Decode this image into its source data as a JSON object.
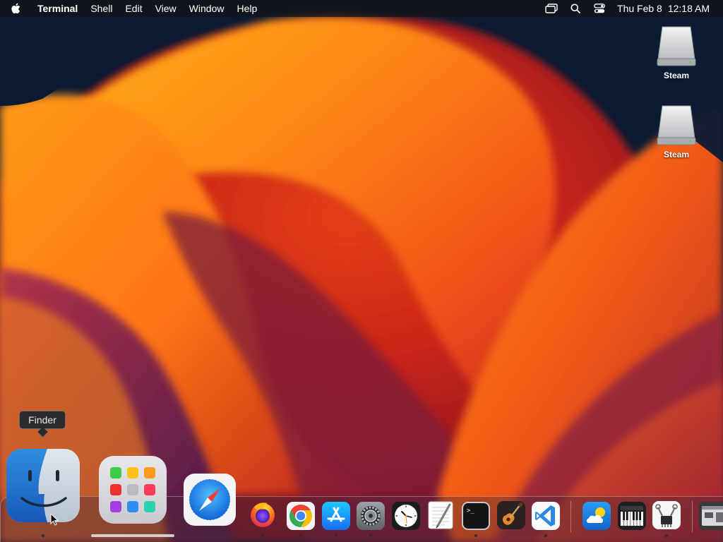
{
  "menubar": {
    "apple_icon": "apple-logo-icon",
    "app_name": "Terminal",
    "menus": [
      "Shell",
      "Edit",
      "View",
      "Window",
      "Help"
    ],
    "status_icons": [
      "screen-mirroring-icon",
      "spotlight-search-icon",
      "control-center-icon"
    ],
    "date": "Thu Feb 8",
    "time": "12:18 AM"
  },
  "desktop": {
    "icons": [
      {
        "label": "Steam",
        "icon": "external-drive-icon"
      },
      {
        "label": "Steam",
        "icon": "external-drive-icon"
      }
    ]
  },
  "tooltip": {
    "text": "Finder"
  },
  "dock": {
    "apps": [
      {
        "name": "Finder",
        "icon": "finder-icon",
        "running": true
      },
      {
        "name": "Launchpad",
        "icon": "launchpad-icon",
        "running": false
      },
      {
        "name": "Safari",
        "icon": "safari-icon",
        "running": false
      },
      {
        "name": "Firefox",
        "icon": "firefox-icon",
        "running": true
      },
      {
        "name": "Google Chrome",
        "icon": "chrome-icon",
        "running": true
      },
      {
        "name": "App Store",
        "icon": "app-store-icon",
        "running": true
      },
      {
        "name": "System Settings",
        "icon": "system-settings-icon",
        "running": true
      },
      {
        "name": "Clock",
        "icon": "clock-icon",
        "running": false
      },
      {
        "name": "TextEdit",
        "icon": "textedit-icon",
        "running": false
      },
      {
        "name": "Terminal",
        "icon": "terminal-icon",
        "running": true
      },
      {
        "name": "GarageBand",
        "icon": "garageband-icon",
        "running": false
      },
      {
        "name": "Visual Studio Code",
        "icon": "vscode-icon",
        "running": true
      },
      {
        "name": "Weather",
        "icon": "weather-icon",
        "running": false
      },
      {
        "name": "Piano",
        "icon": "piano-icon",
        "running": false
      },
      {
        "name": "System Information",
        "icon": "system-information-icon",
        "running": true
      },
      {
        "name": "Window",
        "icon": "window-icon",
        "running": false
      }
    ]
  },
  "colors": {
    "wallpaper_orange": "#ff7a10",
    "wallpaper_red": "#d8261c",
    "wallpaper_purple": "#6a1f4a",
    "wallpaper_navy": "#0a1a33"
  }
}
